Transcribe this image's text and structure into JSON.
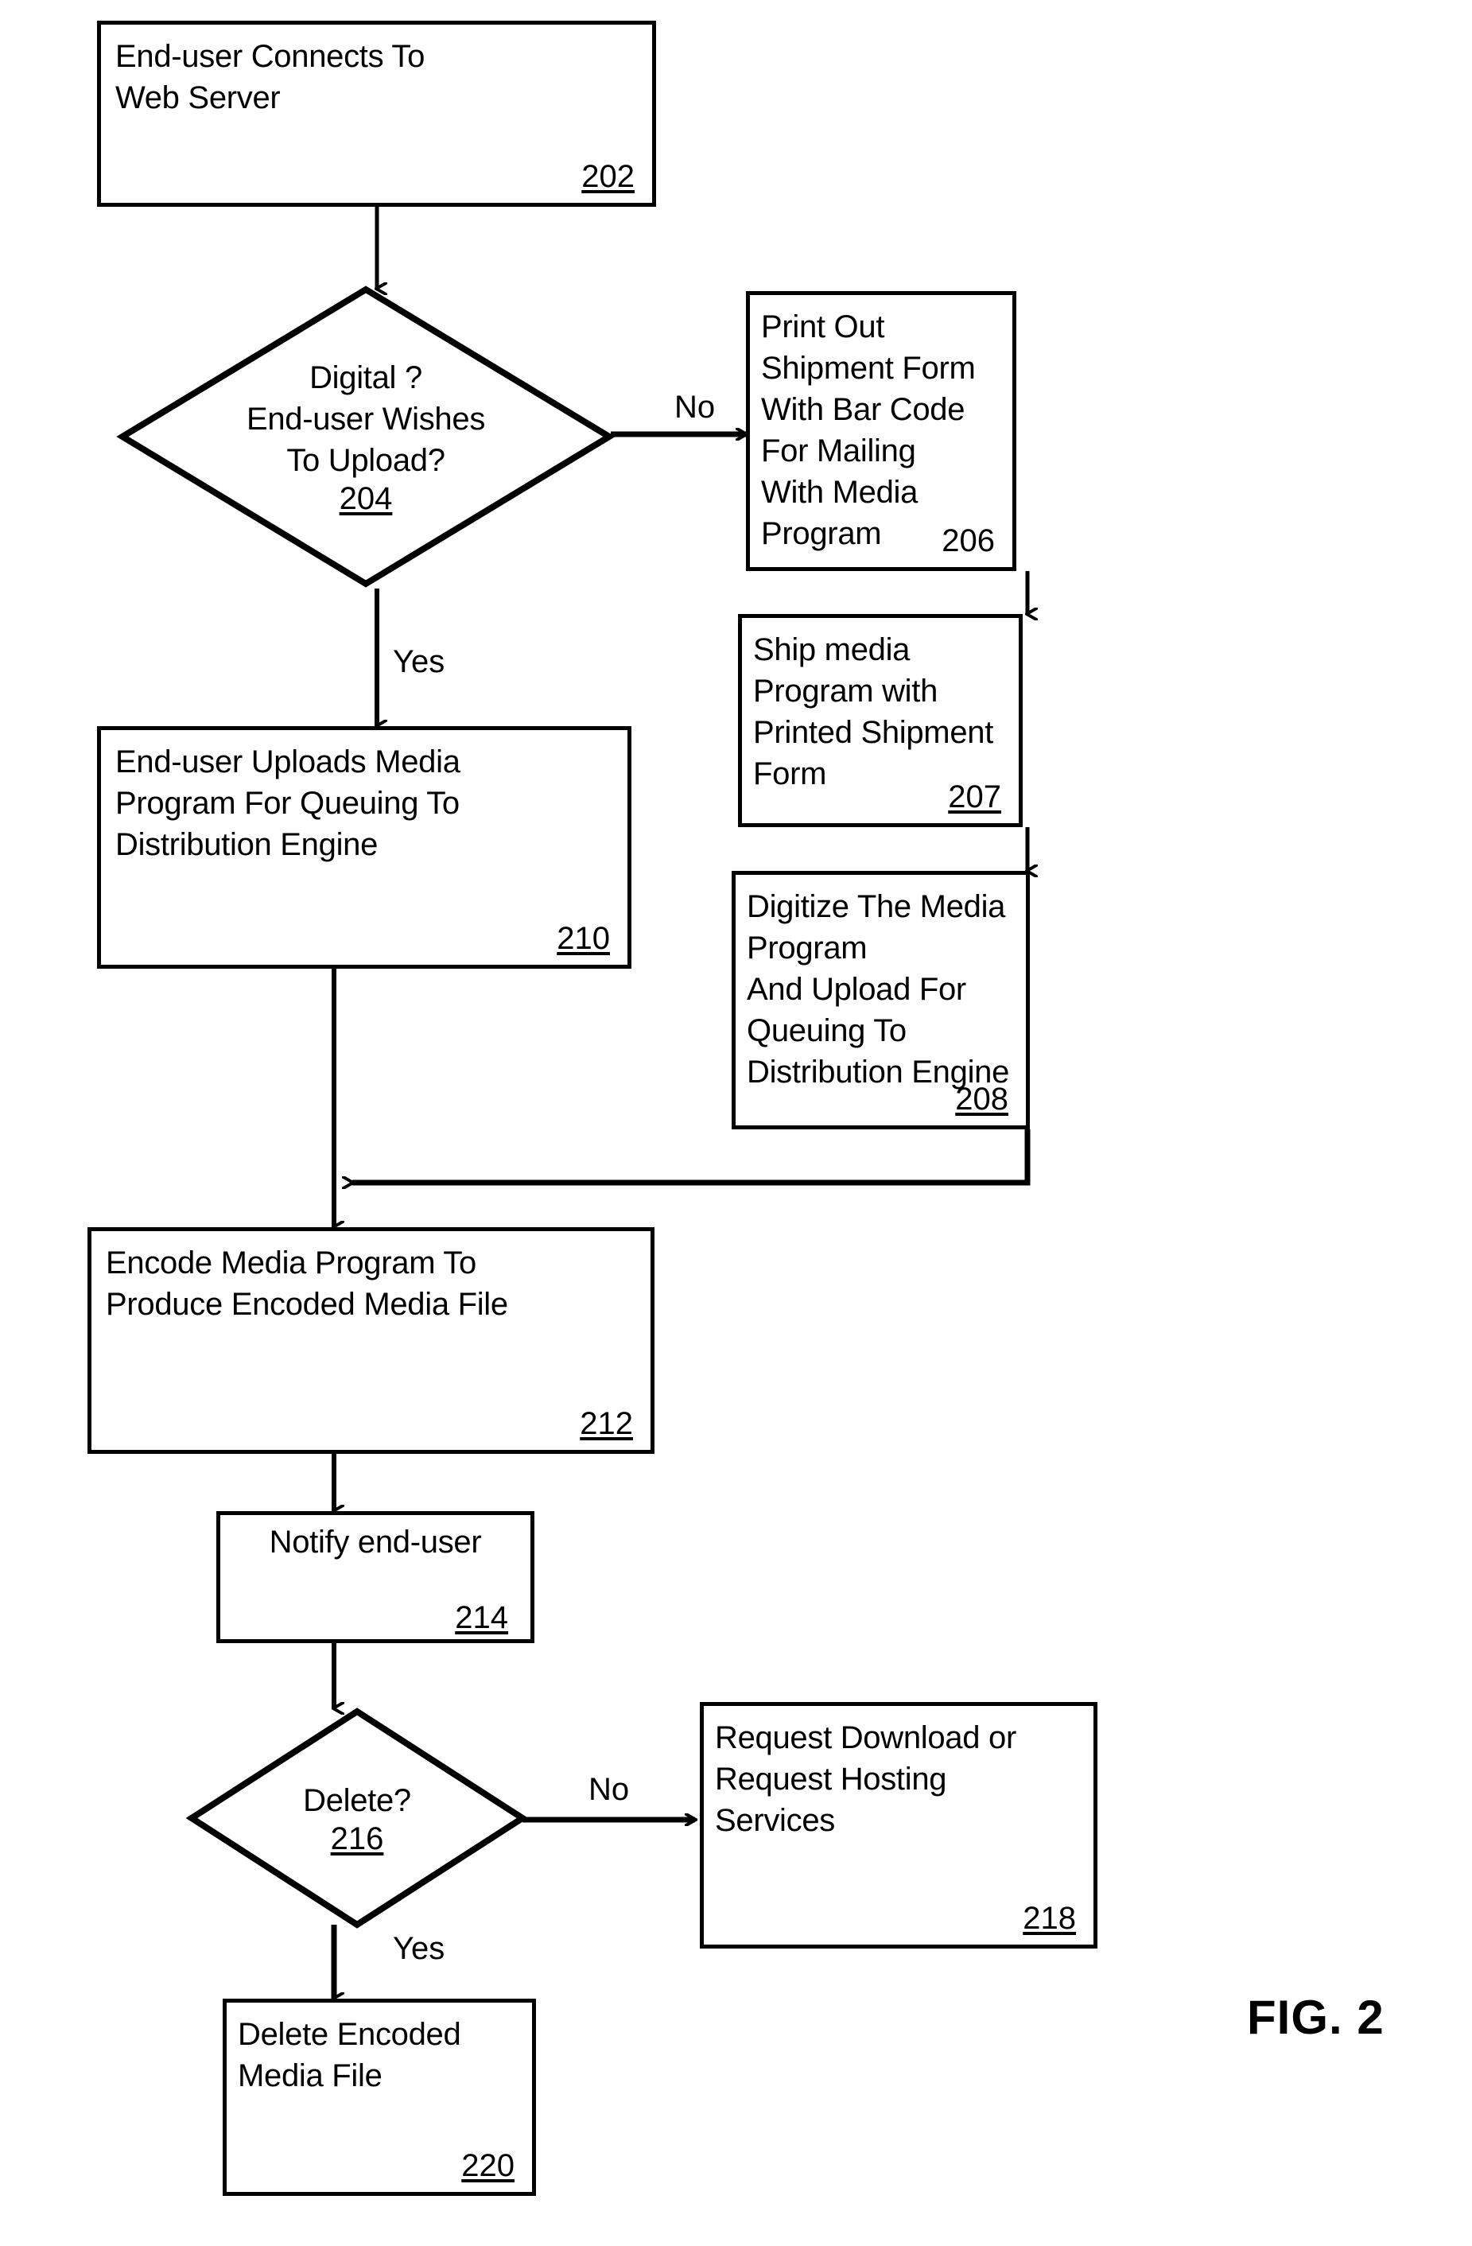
{
  "figure": {
    "caption": "FIG. 2",
    "title": "Media program upload, encoding and distribution flowchart"
  },
  "nodes": [
    {
      "id": "n202",
      "shape": "process",
      "text": "End-user Connects To\nWeb Server",
      "ref": "202",
      "ref_underlined": true
    },
    {
      "id": "n204",
      "shape": "decision",
      "text": "Digital ?\nEnd-user Wishes\nTo Upload?",
      "ref": "204",
      "ref_underlined": true
    },
    {
      "id": "n206",
      "shape": "process",
      "text": "Print Out Shipment Form\nWith Bar Code For Mailing\nWith Media Program",
      "ref": "206",
      "ref_underlined": false
    },
    {
      "id": "n207",
      "shape": "process",
      "text": "Ship media Program with\nPrinted Shipment Form",
      "ref": "207",
      "ref_underlined": true
    },
    {
      "id": "n208",
      "shape": "process",
      "text": "Digitize The Media Program\nAnd Upload For Queuing To\nDistribution Engine",
      "ref": "208",
      "ref_underlined": true
    },
    {
      "id": "n210",
      "shape": "process",
      "text": "End-user Uploads Media\nProgram For Queuing To\nDistribution Engine",
      "ref": "210",
      "ref_underlined": true
    },
    {
      "id": "n212",
      "shape": "process",
      "text": "Encode Media Program To\nProduce Encoded Media File",
      "ref": "212",
      "ref_underlined": true
    },
    {
      "id": "n214",
      "shape": "process",
      "text": "Notify end-user",
      "ref": "214",
      "ref_underlined": true
    },
    {
      "id": "n216",
      "shape": "decision",
      "text": "Delete?",
      "ref": "216",
      "ref_underlined": true
    },
    {
      "id": "n218",
      "shape": "process",
      "text": "Request Download or\nRequest Hosting\nServices",
      "ref": "218",
      "ref_underlined": true
    },
    {
      "id": "n220",
      "shape": "process",
      "text": "Delete Encoded\nMedia File",
      "ref": "220",
      "ref_underlined": true
    }
  ],
  "edge_labels": {
    "digital_no": "No",
    "digital_yes": "Yes",
    "delete_no": "No",
    "delete_yes": "Yes"
  },
  "flow": [
    {
      "from": "202",
      "to": "204",
      "label": ""
    },
    {
      "from": "204",
      "to": "206",
      "label": "No"
    },
    {
      "from": "204",
      "to": "210",
      "label": "Yes"
    },
    {
      "from": "206",
      "to": "207",
      "label": ""
    },
    {
      "from": "207",
      "to": "208",
      "label": ""
    },
    {
      "from": "208",
      "to": "212",
      "label": ""
    },
    {
      "from": "210",
      "to": "212",
      "label": ""
    },
    {
      "from": "212",
      "to": "214",
      "label": ""
    },
    {
      "from": "214",
      "to": "216",
      "label": ""
    },
    {
      "from": "216",
      "to": "218",
      "label": "No"
    },
    {
      "from": "216",
      "to": "220",
      "label": "Yes"
    }
  ],
  "colors": {
    "stroke": "#000000",
    "fill": "#ffffff",
    "text": "#000000"
  }
}
